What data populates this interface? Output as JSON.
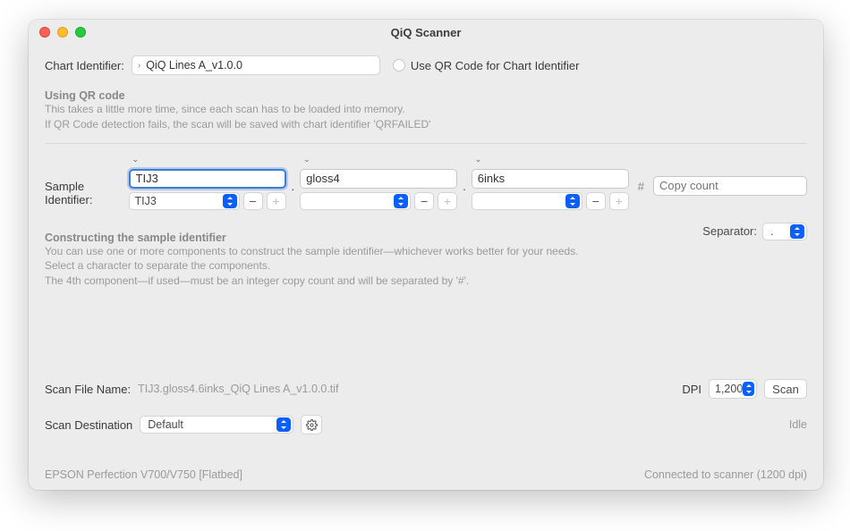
{
  "window": {
    "title": "QiQ Scanner"
  },
  "chart": {
    "label": "Chart Identifier:",
    "value": "QiQ Lines A_v1.0.0",
    "qr_checkbox_label": "Use QR Code for Chart Identifier"
  },
  "qr_info": {
    "title": "Using QR code",
    "line1": "This takes a little more time, since each scan has to be loaded into memory.",
    "line2": "If QR Code detection fails, the scan will be saved with chart identifier 'QRFAILED'"
  },
  "sample": {
    "label": "Sample Identifier:",
    "components": [
      {
        "text_value": "TIJ3",
        "select_value": "TIJ3",
        "minus_enabled": true,
        "plus_enabled": false
      },
      {
        "text_value": "gloss4",
        "select_value": "",
        "minus_enabled": true,
        "plus_enabled": false
      },
      {
        "text_value": "6inks",
        "select_value": "",
        "minus_enabled": true,
        "plus_enabled": false
      }
    ],
    "hash": "#",
    "copy_count_placeholder": "Copy count"
  },
  "construct_info": {
    "title": "Constructing the sample identifier",
    "line1": "You can use one or more components to construct the sample identifier—whichever works better for your needs.",
    "line2": "Select a character to separate the components.",
    "line3": "The 4th component—if used—must be an integer copy count and will be separated by '#'."
  },
  "separator": {
    "label": "Separator:",
    "value": "."
  },
  "scanfile": {
    "label": "Scan File Name:",
    "value": "TIJ3.gloss4.6inks_QiQ Lines A_v1.0.0.tif"
  },
  "dpi": {
    "label": "DPI",
    "value": "1,200"
  },
  "scan_button": "Scan",
  "destination": {
    "label": "Scan Destination",
    "value": "Default"
  },
  "status": "Idle",
  "footer": {
    "device": "EPSON Perfection V700/V750 [Flatbed]",
    "connection": "Connected to scanner (1200 dpi)"
  }
}
